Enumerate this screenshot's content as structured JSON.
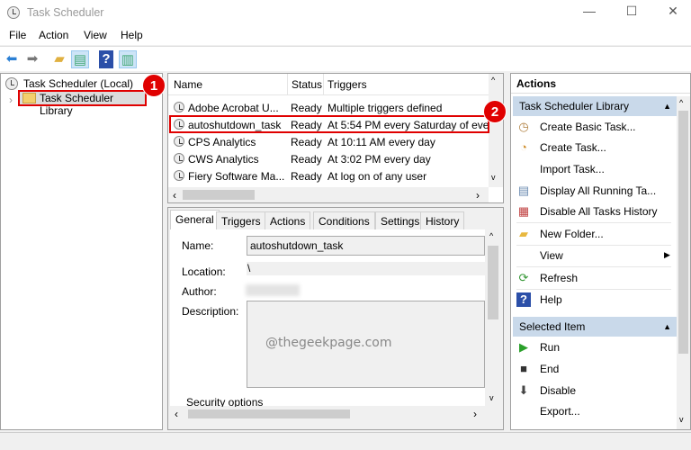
{
  "window": {
    "title": "Task Scheduler",
    "minimize": "—",
    "maximize": "☐",
    "close": "✕"
  },
  "menu": [
    "File",
    "Action",
    "View",
    "Help"
  ],
  "toolbar": {
    "icons": [
      "back-arrow-icon",
      "forward-arrow-icon",
      "up-folder-icon",
      "show-hide-console-tree-icon",
      "help-icon",
      "show-hide-action-pane-icon"
    ]
  },
  "tree": {
    "root": "Task Scheduler (Local)",
    "child": "Task Scheduler Library"
  },
  "tasks": {
    "columns": [
      "Name",
      "Status",
      "Triggers"
    ],
    "rows": [
      {
        "name": "Adobe Acrobat U...",
        "status": "Ready",
        "trigger": "Multiple triggers defined"
      },
      {
        "name": "autoshutdown_task",
        "status": "Ready",
        "trigger": "At 5:54 PM every Saturday of every"
      },
      {
        "name": "CPS Analytics",
        "status": "Ready",
        "trigger": "At 10:11 AM every day"
      },
      {
        "name": "CWS Analytics",
        "status": "Ready",
        "trigger": "At 3:02 PM every day"
      },
      {
        "name": "Fiery Software Ma...",
        "status": "Ready",
        "trigger": "At log on of any user"
      }
    ]
  },
  "details": {
    "tabs": [
      "General",
      "Triggers",
      "Actions",
      "Conditions",
      "Settings",
      "History"
    ],
    "active_tab": "General",
    "name_label": "Name:",
    "name_value": "autoshutdown_task",
    "location_label": "Location:",
    "location_value": "\\",
    "author_label": "Author:",
    "description_label": "Description:",
    "security_label": "Security options"
  },
  "watermark": "@thegeekpage.com",
  "actions": {
    "title": "Actions",
    "section1": "Task Scheduler Library",
    "items1": [
      {
        "label": "Create Basic Task...",
        "icon": "create-basic-task-icon"
      },
      {
        "label": "Create Task...",
        "icon": "create-task-icon"
      },
      {
        "label": "Import Task...",
        "icon": ""
      },
      {
        "label": "Display All Running Ta...",
        "icon": "running-tasks-icon"
      },
      {
        "label": "Disable All Tasks History",
        "icon": "history-icon"
      },
      {
        "label": "New Folder...",
        "icon": "folder-icon"
      },
      {
        "label": "View",
        "icon": ""
      },
      {
        "label": "Refresh",
        "icon": "refresh-icon"
      },
      {
        "label": "Help",
        "icon": "help-icon"
      }
    ],
    "section2": "Selected Item",
    "items2": [
      {
        "label": "Run",
        "icon": "run-icon"
      },
      {
        "label": "End",
        "icon": "end-icon"
      },
      {
        "label": "Disable",
        "icon": "disable-icon"
      },
      {
        "label": "Export...",
        "icon": ""
      }
    ]
  },
  "badges": [
    "1",
    "2"
  ],
  "colors": {
    "highlight": "#e00000",
    "section_header": "#c9d9ea"
  }
}
